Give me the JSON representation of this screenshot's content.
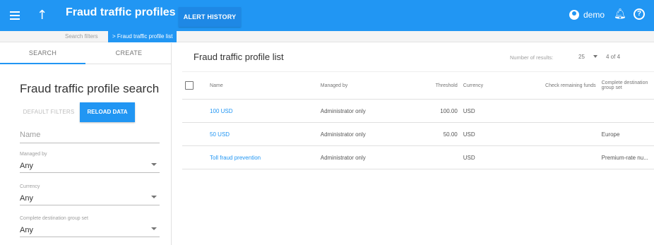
{
  "header": {
    "title": "Fraud traffic profiles",
    "alert_history_label": "ALERT HISTORY",
    "user_name": "demo"
  },
  "breadcrumb": {
    "parent": "Search filters",
    "current": "> Fraud traffic profile list"
  },
  "left_panel": {
    "tabs": [
      {
        "label": "SEARCH",
        "active": true
      },
      {
        "label": "CREATE",
        "active": false
      }
    ],
    "title": "Fraud traffic profile search",
    "default_filters_label": "DEFAULT FILTERS",
    "reload_data_label": "RELOAD DATA",
    "name_placeholder": "Name",
    "fields": [
      {
        "label": "Managed by",
        "value": "Any"
      },
      {
        "label": "Currency",
        "value": "Any"
      },
      {
        "label": "Complete destination group set",
        "value": "Any"
      }
    ]
  },
  "main": {
    "title": "Fraud traffic profile list",
    "results_label": "Number of results:",
    "results_per_page": "25",
    "results_count": "4 of 4",
    "columns": [
      "Name",
      "Managed by",
      "Threshold",
      "Currency",
      "Check remaining funds",
      "Complete destination group set"
    ],
    "rows": [
      {
        "name": "100 USD",
        "managed_by": "Administrator only",
        "threshold": "100.00",
        "currency": "USD",
        "check_remaining_funds": "",
        "destination_group_set": ""
      },
      {
        "name": "50 USD",
        "managed_by": "Administrator only",
        "threshold": "50.00",
        "currency": "USD",
        "check_remaining_funds": "",
        "destination_group_set": "Europe"
      },
      {
        "name": "Toll fraud prevention",
        "managed_by": "Administrator only",
        "threshold": "",
        "currency": "USD",
        "check_remaining_funds": "",
        "destination_group_set": "Premium-rate nu..."
      }
    ]
  },
  "colors": {
    "primary": "#2196f3",
    "link": "#2196f3"
  },
  "icons": [
    "menu-icon",
    "arrow-up-icon",
    "account-circle-icon",
    "bell-icon",
    "help-icon",
    "chevron-down-icon",
    "checkbox-icon"
  ]
}
